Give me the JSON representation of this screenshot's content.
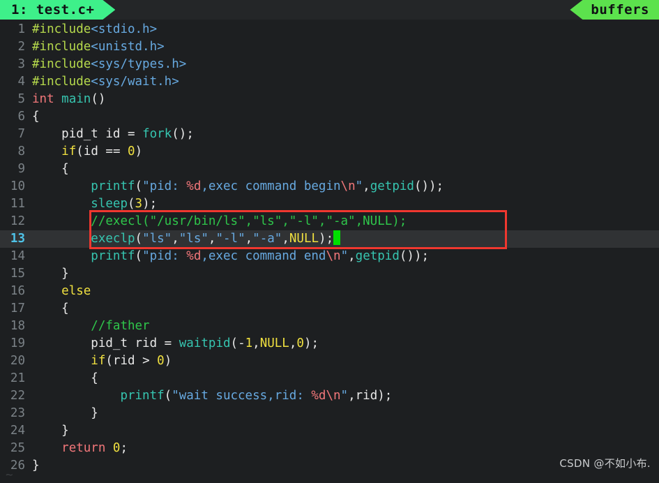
{
  "tabline": {
    "active_tab": "1: test.c+",
    "right_label": "buffers"
  },
  "editor": {
    "cursor_line": 13,
    "colors": {
      "background": "#1d1f21",
      "current_line_bg": "#303234",
      "tab_active_bg": "#3ef08a",
      "tab_right_bg": "#5ce24d",
      "line_number": "#7b8287",
      "current_line_number": "#4fc3e8",
      "cursor": "#00e000",
      "annotation_box": "#f0372f",
      "preprocessor": "#b5d94c",
      "header": "#67a9e0",
      "type_keyword": "#f2777a",
      "function": "#36c5b0",
      "keyword": "#f0e040",
      "number": "#f0e040",
      "string": "#67a9e0",
      "escape": "#f2777a",
      "comment": "#2fc64b"
    },
    "lines": [
      {
        "n": "1",
        "text": "#include<stdio.h>"
      },
      {
        "n": "2",
        "text": "#include<unistd.h>"
      },
      {
        "n": "3",
        "text": "#include<sys/types.h>"
      },
      {
        "n": "4",
        "text": "#include<sys/wait.h>"
      },
      {
        "n": "5",
        "text": "int main()"
      },
      {
        "n": "6",
        "text": "{"
      },
      {
        "n": "7",
        "text": "    pid_t id = fork();"
      },
      {
        "n": "8",
        "text": "    if(id == 0)"
      },
      {
        "n": "9",
        "text": "    {"
      },
      {
        "n": "10",
        "text": "        printf(\"pid: %d,exec command begin\\n\",getpid());"
      },
      {
        "n": "11",
        "text": "        sleep(3);"
      },
      {
        "n": "12",
        "text": "        //execl(\"/usr/bin/ls\",\"ls\",\"-l\",\"-a\",NULL);"
      },
      {
        "n": "13",
        "text": "        execlp(\"ls\",\"ls\",\"-l\",\"-a\",NULL);"
      },
      {
        "n": "14",
        "text": "        printf(\"pid: %d,exec command end\\n\",getpid());"
      },
      {
        "n": "15",
        "text": "    }"
      },
      {
        "n": "16",
        "text": "    else"
      },
      {
        "n": "17",
        "text": "    {"
      },
      {
        "n": "18",
        "text": "        //father"
      },
      {
        "n": "19",
        "text": "        pid_t rid = waitpid(-1,NULL,0);"
      },
      {
        "n": "20",
        "text": "        if(rid > 0)"
      },
      {
        "n": "21",
        "text": "        {"
      },
      {
        "n": "22",
        "text": "            printf(\"wait success,rid: %d\\n\",rid);"
      },
      {
        "n": "23",
        "text": "        }"
      },
      {
        "n": "24",
        "text": "    }"
      },
      {
        "n": "25",
        "text": "    return 0;"
      },
      {
        "n": "26",
        "text": "}"
      }
    ],
    "empty_marker": "~"
  },
  "watermark": "CSDN @不如小布."
}
